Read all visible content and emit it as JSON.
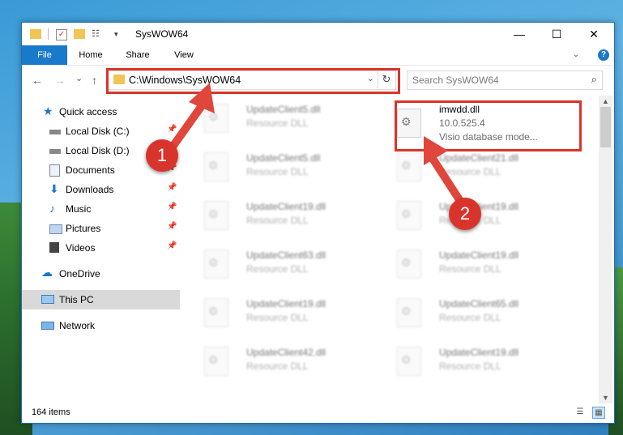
{
  "window": {
    "title": "SysWOW64",
    "minimize_glyph": "—",
    "maximize_glyph": "☐",
    "close_glyph": "✕"
  },
  "ribbon": {
    "tabs": [
      "File",
      "Home",
      "Share",
      "View"
    ],
    "help_glyph": "?"
  },
  "address": {
    "path": "C:\\Windows\\SysWOW64",
    "chevron_glyph": "⌄",
    "refresh_glyph": "↻"
  },
  "search": {
    "placeholder": "Search SysWOW64",
    "icon_glyph": "⌕"
  },
  "nav_buttons": {
    "back": "←",
    "forward": "→",
    "recent": "⌄",
    "up": "↑"
  },
  "sidebar": {
    "items": [
      {
        "label": "Quick access",
        "icon": "star-icon",
        "pinned": false
      },
      {
        "label": "Local Disk (C:)",
        "icon": "drive-icon",
        "pinned": true
      },
      {
        "label": "Local Disk (D:)",
        "icon": "drive-icon",
        "pinned": true
      },
      {
        "label": "Documents",
        "icon": "documents-icon",
        "pinned": true
      },
      {
        "label": "Downloads",
        "icon": "downloads-icon",
        "pinned": true
      },
      {
        "label": "Music",
        "icon": "music-icon",
        "pinned": true
      },
      {
        "label": "Pictures",
        "icon": "pictures-icon",
        "pinned": true
      },
      {
        "label": "Videos",
        "icon": "videos-icon",
        "pinned": true
      },
      {
        "label": "OneDrive",
        "icon": "onedrive-icon",
        "pinned": false
      },
      {
        "label": "This PC",
        "icon": "this-pc-icon",
        "pinned": false
      },
      {
        "label": "Network",
        "icon": "network-icon",
        "pinned": false
      }
    ],
    "pin_glyph": "📌"
  },
  "files": {
    "highlighted": {
      "name": "imwdd.dll",
      "version": "10.0.525.4",
      "description": "Visio database mode..."
    },
    "left_column": [
      {
        "name": "UpdateClient5.dll",
        "type": "Resource DLL"
      },
      {
        "name": "UpdateClient5.dll",
        "type": "Resource DLL"
      },
      {
        "name": "UpdateClient19.dll",
        "type": "Resource DLL"
      },
      {
        "name": "UpdateClient63.dll",
        "type": "Resource DLL"
      },
      {
        "name": "UpdateClient19.dll",
        "type": "Resource DLL"
      },
      {
        "name": "UpdateClient42.dll",
        "type": "Resource DLL"
      }
    ],
    "right_column": [
      {
        "name": "UpdateClient21.dll",
        "type": "Resource DLL"
      },
      {
        "name": "UpdateClient19.dll",
        "type": "Resource DLL"
      },
      {
        "name": "UpdateClient19.dll",
        "type": "Resource DLL"
      },
      {
        "name": "UpdateClient65.dll",
        "type": "Resource DLL"
      },
      {
        "name": "UpdateClient19.dll",
        "type": "Resource DLL"
      }
    ]
  },
  "status": {
    "items_count": "164 items"
  },
  "annotations": {
    "step1": "1",
    "step2": "2",
    "color": "#d9342b"
  }
}
